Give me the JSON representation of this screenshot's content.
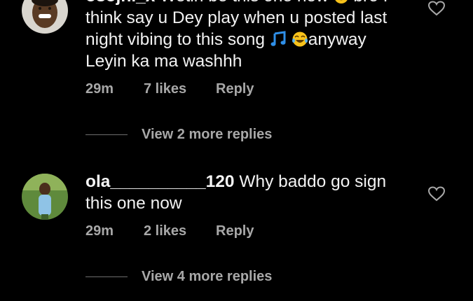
{
  "comments": [
    {
      "username": "osojhi_x",
      "text_line1": " Wetin be this one now",
      "text_line1b": " bro I",
      "text_line2": "think say u Dey play when u posted last",
      "text_line3a": "night vibing to this song ",
      "text_line3b": "anyway",
      "text_line4": "Leyin ka ma washhh",
      "time": "29m",
      "likes": "7 likes",
      "reply": "Reply",
      "more_replies": "View 2 more replies",
      "icons": [
        "avatar-smiling-man",
        "smiling-emoji",
        "music-note-emoji",
        "tears-of-joy-emoji",
        "heart-outline-icon"
      ]
    },
    {
      "username": "ola__________120",
      "text": " Why baddo go sign",
      "text_line2": "this one now",
      "time": "29m",
      "likes": "2 likes",
      "reply": "Reply",
      "more_replies": "View 4 more replies",
      "icons": [
        "avatar-woman-outdoors",
        "heart-outline-icon"
      ]
    }
  ],
  "colors": {
    "background": "#000000",
    "text": "#f2f2f2",
    "muted": "#a8a8a8",
    "accent_music": "#2f8fe8"
  }
}
